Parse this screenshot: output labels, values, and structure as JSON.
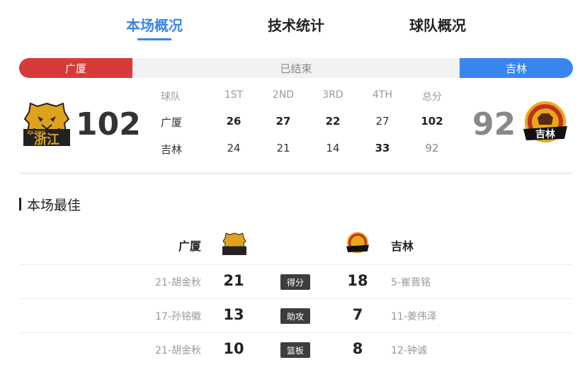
{
  "tabs": [
    {
      "label": "本场概况",
      "active": true
    },
    {
      "label": "技术统计",
      "active": false
    },
    {
      "label": "球队概况",
      "active": false
    }
  ],
  "status": {
    "home_team": "广厦",
    "state": "已结束",
    "away_team": "吉林"
  },
  "score": {
    "home": "102",
    "away": "92"
  },
  "quarters": {
    "headers": [
      "球队",
      "1ST",
      "2ND",
      "3RD",
      "4TH",
      "总分"
    ],
    "rows": [
      {
        "team": "广厦",
        "q1": "26",
        "q2": "27",
        "q3": "22",
        "q4": "27",
        "total": "102"
      },
      {
        "team": "吉林",
        "q1": "24",
        "q2": "21",
        "q3": "14",
        "q4": "33",
        "total": "92"
      }
    ]
  },
  "best": {
    "title": "本场最佳",
    "home_team": "广厦",
    "away_team": "吉林",
    "rows": [
      {
        "home_player": "21-胡金秋",
        "home_value": "21",
        "category": "得分",
        "away_value": "18",
        "away_player": "5-崔晋铭"
      },
      {
        "home_player": "17-孙铭徽",
        "home_value": "13",
        "category": "助攻",
        "away_value": "7",
        "away_player": "11-姜伟泽"
      },
      {
        "home_player": "21-胡金秋",
        "home_value": "10",
        "category": "篮板",
        "away_value": "8",
        "away_player": "12-钟诚"
      }
    ]
  },
  "logos": {
    "home_logo_text": "浙江",
    "home_logo_sub": "ZJLONG",
    "away_logo_text": "吉林"
  },
  "colors": {
    "accent": "#3a86e8",
    "home": "#d83a3a",
    "away": "#3a86f0"
  }
}
